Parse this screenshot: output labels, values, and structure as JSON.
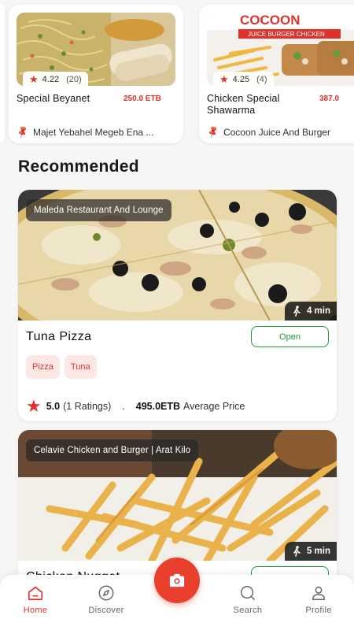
{
  "carousel": {
    "items": [
      {
        "rating": "4.22",
        "count": "(20)",
        "name": "Special Beyanet",
        "price": "250.0 ETB",
        "place": "Majet Yebahel Megeb Ena ..."
      },
      {
        "rating": "4.25",
        "count": "(4)",
        "name": "Chicken Special Shawarma",
        "price": "387.0",
        "place": "Cocoon Juice And Burger",
        "sign_text": "COCOON",
        "sign_sub": "JUICE BURGER CHICKEN"
      }
    ]
  },
  "section_title": "Recommended",
  "cards": [
    {
      "restaurant": "Maleda Restaurant And Lounge",
      "time": "4 min",
      "dish": "Tuna Pizza",
      "status": "Open",
      "tags": [
        "Pizza",
        "Tuna"
      ],
      "score": "5.0",
      "ratings": "(1 Ratings)",
      "dot": ".",
      "price": "495.0ETB",
      "price_label": "Average Price"
    },
    {
      "restaurant": "Celavie Chicken and Burger | Arat Kilo",
      "time": "5 min",
      "dish": "Chicken Nugget"
    }
  ],
  "nav": {
    "home": "Home",
    "discover": "Discover",
    "search": "Search",
    "profile": "Profile"
  },
  "colors": {
    "accent": "#e0312a",
    "open_green": "#1e9a3a",
    "chip_bg": "#fde6e4"
  }
}
